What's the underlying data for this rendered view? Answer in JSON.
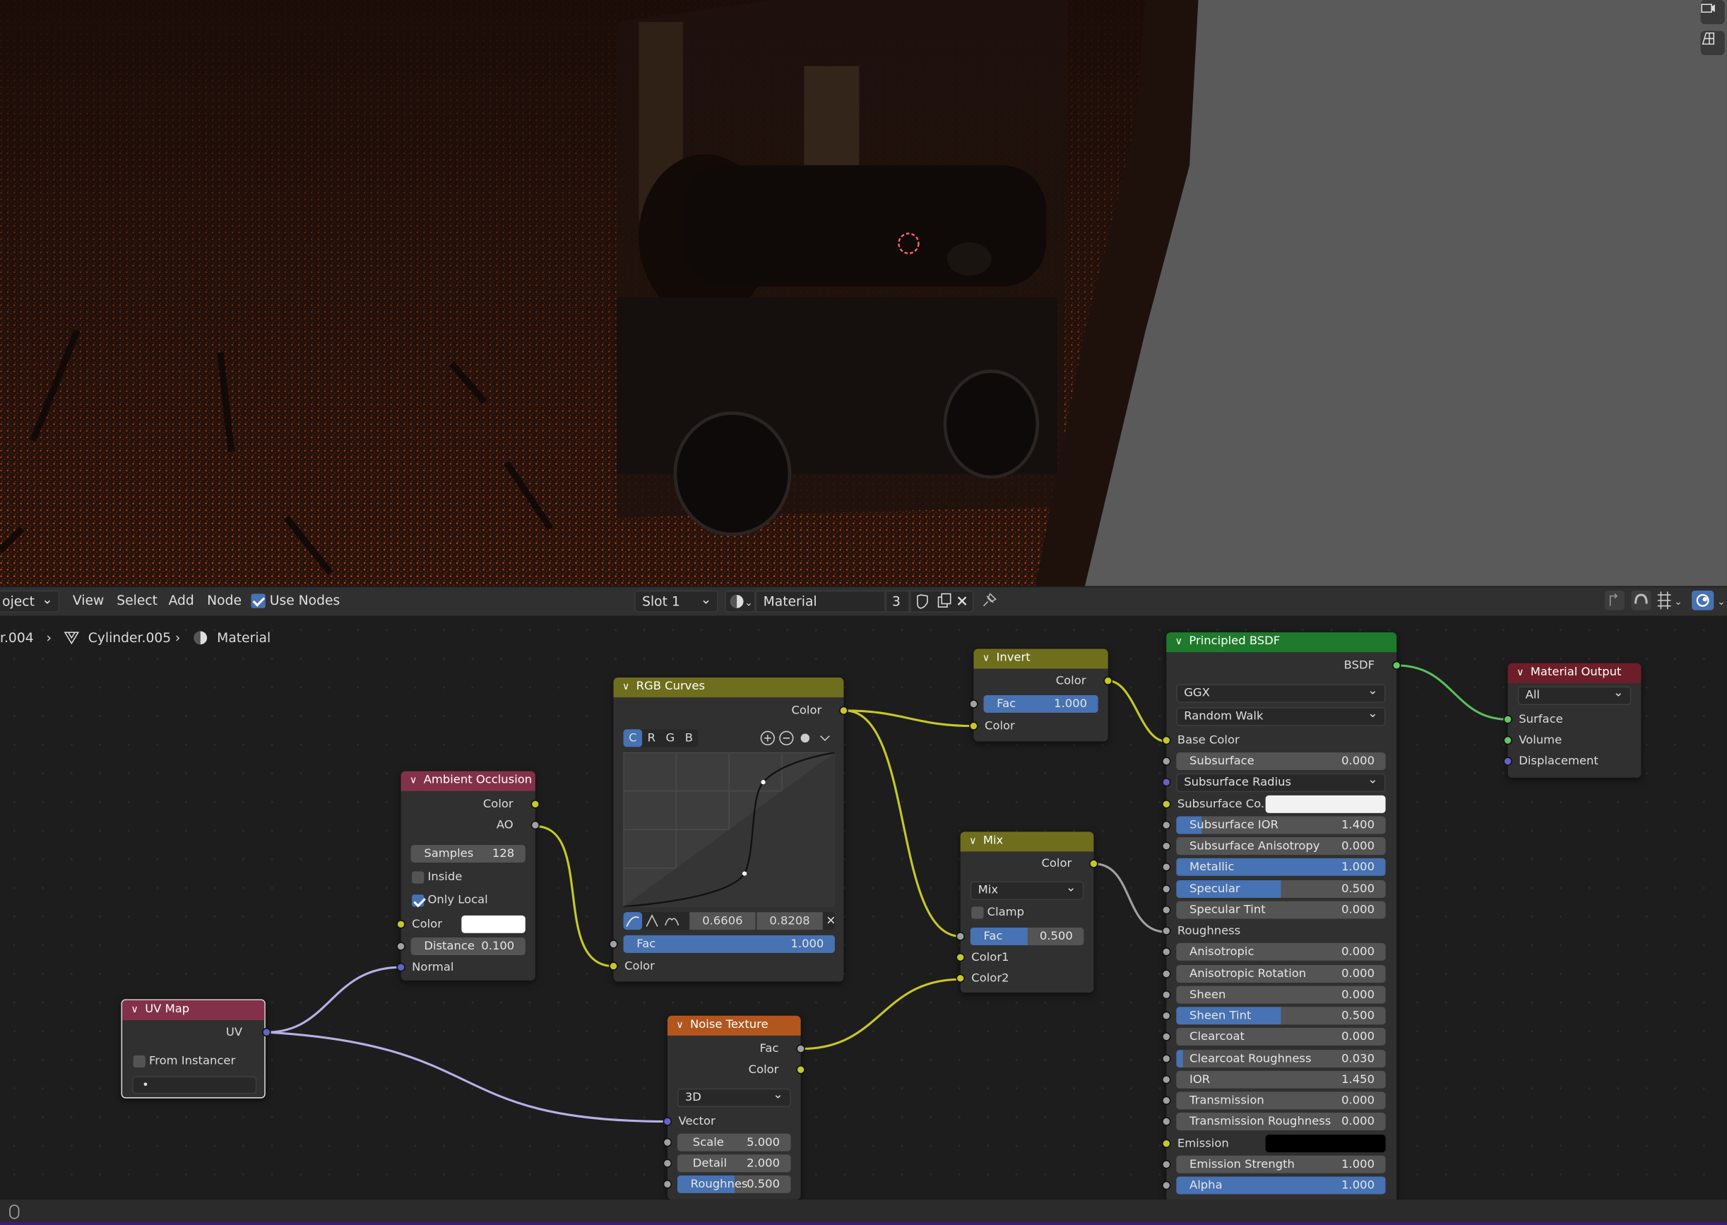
{
  "header": {
    "mode_menu": "oject",
    "menus": [
      "View",
      "Select",
      "Add",
      "Node"
    ],
    "use_nodes_label": "Use Nodes",
    "use_nodes_checked": true,
    "slot": "Slot 1",
    "material_name": "Material",
    "user_count": "3"
  },
  "breadcrumb": {
    "object": "r.004",
    "mesh": "Cylinder.005",
    "material": "Material"
  },
  "nodes": {
    "rgb_curves": {
      "title": "RGB Curves",
      "out_color": "Color",
      "channels": [
        "C",
        "R",
        "G",
        "B"
      ],
      "point_x": "0.6606",
      "point_y": "0.8208",
      "fac_label": "Fac",
      "fac_value": "1.000",
      "fac_fraction": 1.0,
      "in_color": "Color"
    },
    "invert": {
      "title": "Invert",
      "out_color": "Color",
      "fac_label": "Fac",
      "fac_value": "1.000",
      "in_color": "Color"
    },
    "ambient_occlusion": {
      "title": "Ambient Occlusion",
      "out_color": "Color",
      "out_ao": "AO",
      "samples_label": "Samples",
      "samples_value": "128",
      "inside_label": "Inside",
      "inside_checked": false,
      "only_local_label": "Only Local",
      "only_local_checked": true,
      "color_label": "Color",
      "color_value": "#ffffff",
      "distance_label": "Distance",
      "distance_value": "0.100",
      "normal_label": "Normal"
    },
    "mix": {
      "title": "Mix",
      "out_color": "Color",
      "blend": "Mix",
      "clamp_label": "Clamp",
      "clamp_checked": false,
      "fac_label": "Fac",
      "fac_value": "0.500",
      "fac_fraction": 0.5,
      "color1": "Color1",
      "color2": "Color2"
    },
    "uv_map": {
      "title": "UV Map",
      "out_uv": "UV",
      "from_instancer_label": "From Instancer",
      "from_instancer_checked": false,
      "uv_field": "•"
    },
    "noise_texture": {
      "title": "Noise Texture",
      "out_fac": "Fac",
      "out_color": "Color",
      "dimensions": "3D",
      "vector_label": "Vector",
      "scale_label": "Scale",
      "scale_value": "5.000",
      "detail_label": "Detail",
      "detail_value": "2.000",
      "roughness_label": "Roughnes",
      "roughness_value": "0.500",
      "roughness_fraction": 0.5
    },
    "principled_bsdf": {
      "title": "Principled BSDF",
      "out_bsdf": "BSDF",
      "distribution": "GGX",
      "subsurface_method": "Random Walk",
      "base_color_label": "Base Color",
      "subsurface_radius_label": "Subsurface Radius",
      "subsurface_color_label": "Subsurface Co...",
      "roughness_label": "Roughness",
      "emission_label": "Emission",
      "fields": [
        {
          "label": "Subsurface",
          "value": "0.000",
          "fraction": 0
        },
        {
          "label": "Subsurface IOR",
          "value": "1.400",
          "fraction": 0.12
        },
        {
          "label": "Subsurface Anisotropy",
          "value": "0.000",
          "fraction": 0
        },
        {
          "label": "Metallic",
          "value": "1.000",
          "fraction": 1
        },
        {
          "label": "Specular",
          "value": "0.500",
          "fraction": 0.5
        },
        {
          "label": "Specular Tint",
          "value": "0.000",
          "fraction": 0
        },
        {
          "label": "Anisotropic",
          "value": "0.000",
          "fraction": 0
        },
        {
          "label": "Anisotropic Rotation",
          "value": "0.000",
          "fraction": 0
        },
        {
          "label": "Sheen",
          "value": "0.000",
          "fraction": 0
        },
        {
          "label": "Sheen Tint",
          "value": "0.500",
          "fraction": 0.5
        },
        {
          "label": "Clearcoat",
          "value": "0.000",
          "fraction": 0
        },
        {
          "label": "Clearcoat Roughness",
          "value": "0.030",
          "fraction": 0.03
        },
        {
          "label": "IOR",
          "value": "1.450",
          "fraction": 0
        },
        {
          "label": "Transmission",
          "value": "0.000",
          "fraction": 0
        },
        {
          "label": "Transmission Roughness",
          "value": "0.000",
          "fraction": 0
        },
        {
          "label": "Emission Strength",
          "value": "1.000",
          "fraction": 0
        },
        {
          "label": "Alpha",
          "value": "1.000",
          "fraction": 1
        }
      ],
      "subsurface_color": "#f2f2f2",
      "emission_color": "#000000"
    },
    "material_output": {
      "title": "Material Output",
      "target": "All",
      "surface": "Surface",
      "volume": "Volume",
      "displacement": "Displacement"
    }
  },
  "colors": {
    "input_header": "#83314a",
    "color_header": "#6e6e1d",
    "shader_header": "#1f7a2b",
    "texture_header": "#b2561e",
    "output_header": "#6e1e28",
    "link_yellow": "#c7c729",
    "link_gray": "#a1a1a1",
    "link_purple": "#b7b0e6",
    "link_green": "#5dbd5d",
    "accent": "#4772b3"
  }
}
